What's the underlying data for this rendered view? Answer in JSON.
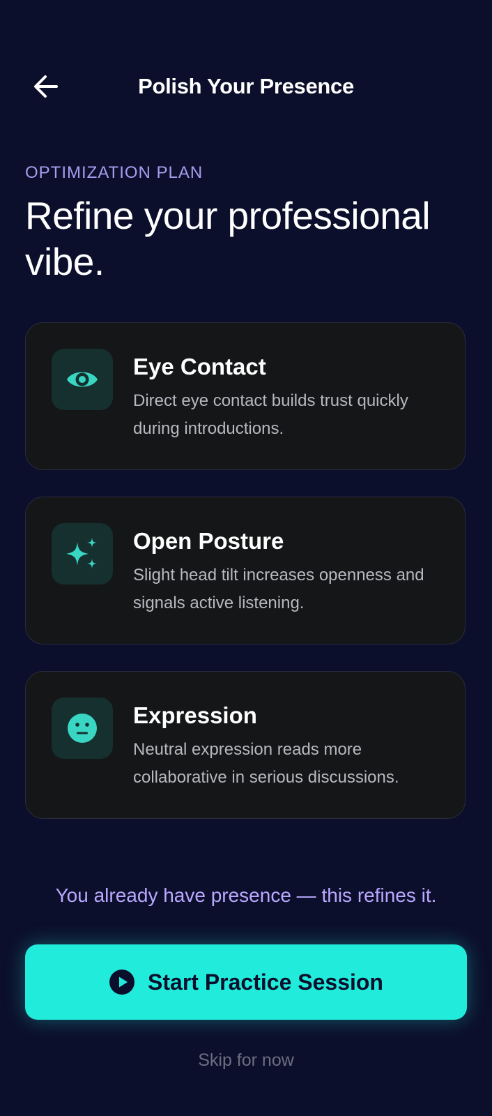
{
  "header": {
    "back_icon": "arrow-left-icon",
    "title": "Polish Your Presence"
  },
  "intro": {
    "eyebrow": "OPTIMIZATION PLAN",
    "headline": "Refine your professional vibe."
  },
  "cards": [
    {
      "icon": "eye-icon",
      "title": "Eye Contact",
      "description": "Direct eye contact builds trust quickly during introductions."
    },
    {
      "icon": "sparkles-icon",
      "title": "Open Posture",
      "description": "Slight head tilt increases openness and signals active listening."
    },
    {
      "icon": "neutral-face-icon",
      "title": "Expression",
      "description": "Neutral expression reads more collaborative in serious discussions."
    }
  ],
  "reassurance": "You already have presence — this refines it.",
  "cta": {
    "icon": "play-circle-icon",
    "label": "Start Practice Session"
  },
  "skip_label": "Skip for now",
  "colors": {
    "background": "#0c0f2b",
    "accent": "#21ecdb",
    "eyebrow": "#a79cf0",
    "reassurance": "#b9a8ff",
    "card_bg": "#151617",
    "icon_tile": "#15302f"
  }
}
